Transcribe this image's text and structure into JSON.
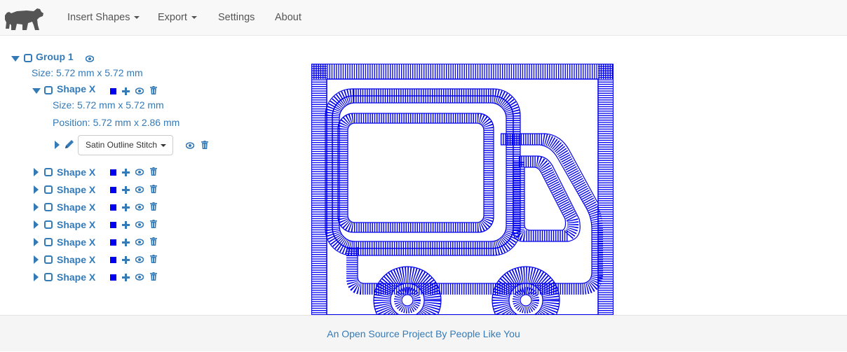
{
  "navbar": {
    "logo_icon": "bear-icon",
    "items": [
      {
        "label": "Insert Shapes",
        "dropdown": true
      },
      {
        "label": "Export",
        "dropdown": true
      },
      {
        "label": "Settings",
        "dropdown": false
      },
      {
        "label": "About",
        "dropdown": false
      }
    ]
  },
  "tree": {
    "group": {
      "label": "Group 1",
      "size": "Size: 5.72 mm x 5.72 mm"
    },
    "expanded_shape": {
      "label": "Shape X",
      "size": "Size: 5.72 mm x 5.72 mm",
      "position": "Position: 5.72 mm x 2.86 mm",
      "stitch_select": "Satin Outline Stitch"
    },
    "collapsed_shapes": [
      {
        "label": "Shape X"
      },
      {
        "label": "Shape X"
      },
      {
        "label": "Shape X"
      },
      {
        "label": "Shape X"
      },
      {
        "label": "Shape X"
      },
      {
        "label": "Shape X"
      },
      {
        "label": "Shape X"
      }
    ]
  },
  "colors": {
    "link": "#337ab7",
    "stitch": "#0000ee"
  },
  "footer": {
    "text": "An Open Source Project By People Like You"
  }
}
